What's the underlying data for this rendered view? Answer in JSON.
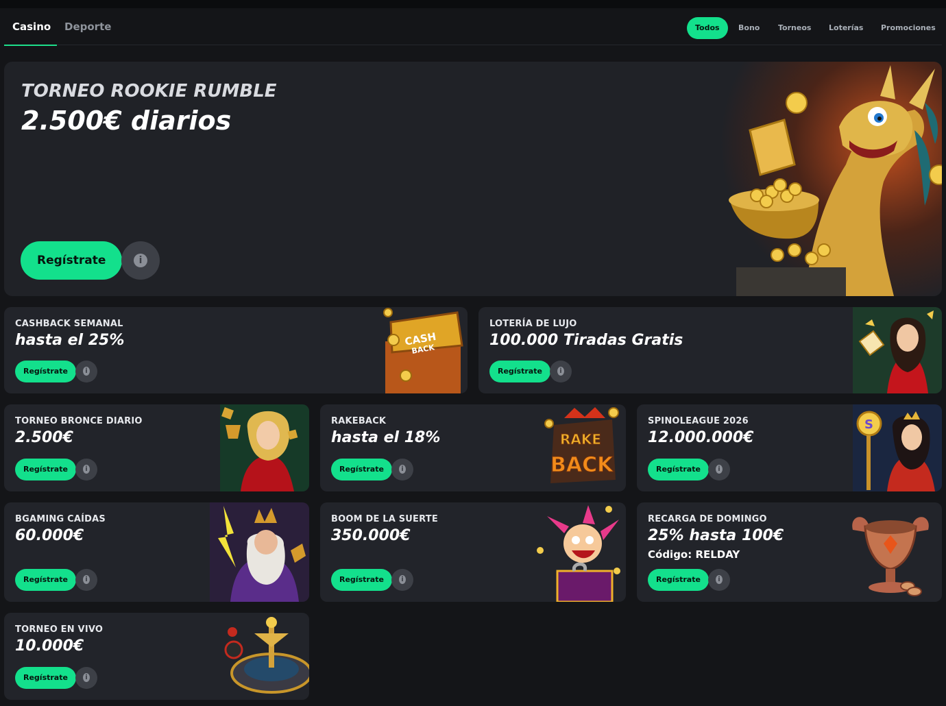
{
  "nav": {
    "main_tabs": [
      {
        "label": "Casino",
        "active": true
      },
      {
        "label": "Deporte",
        "active": false
      }
    ],
    "filters": [
      {
        "label": "Todos",
        "active": true
      },
      {
        "label": "Bono",
        "active": false
      },
      {
        "label": "Torneos",
        "active": false
      },
      {
        "label": "Loterías",
        "active": false
      },
      {
        "label": "Promociones",
        "active": false
      }
    ]
  },
  "hero": {
    "eyebrow": "TORNEO ROOKIE RUMBLE",
    "title": "2.500€ diarios",
    "button": "Regístrate",
    "art": "golden-dragon-with-coin-bowl"
  },
  "promos": [
    {
      "eyebrow": "CASHBACK SEMANAL",
      "headline": "hasta el 25%",
      "button": "Regístrate",
      "art": "cashback-treasure-chest"
    },
    {
      "eyebrow": "LOTERÍA DE LUJO",
      "headline": "100.000 Tiradas Gratis",
      "button": "Regístrate",
      "art": "lady-with-cards"
    },
    {
      "eyebrow": "TORNEO BRONCE DIARIO",
      "headline": "2.500€",
      "button": "Regístrate",
      "art": "lady-with-trophy"
    },
    {
      "eyebrow": "RAKEBACK",
      "headline": "hasta el 18%",
      "button": "Regístrate",
      "art": "rakeback-logo"
    },
    {
      "eyebrow": "SPINOLEAGUE 2026",
      "headline": "12.000.000€",
      "button": "Regístrate",
      "art": "queen-with-coin"
    },
    {
      "eyebrow": "BGAMING CAÍDAS",
      "headline": "60.000€",
      "button": "Regístrate",
      "art": "zeus-with-lightning"
    },
    {
      "eyebrow": "BOOM DE LA SUERTE",
      "headline": "350.000€",
      "button": "Regístrate",
      "art": "jester-in-box"
    },
    {
      "eyebrow": "RECARGA DE DOMINGO",
      "headline": "25% hasta 100€",
      "extra": "Código: RELDAY",
      "button": "Regístrate",
      "art": "copper-chalice"
    },
    {
      "eyebrow": "TORNEO EN VIVO",
      "headline": "10.000€",
      "button": "Regístrate",
      "art": "roulette-wheel"
    }
  ],
  "colors": {
    "accent": "#13e08c",
    "card": "#22242a",
    "background": "#141518"
  }
}
